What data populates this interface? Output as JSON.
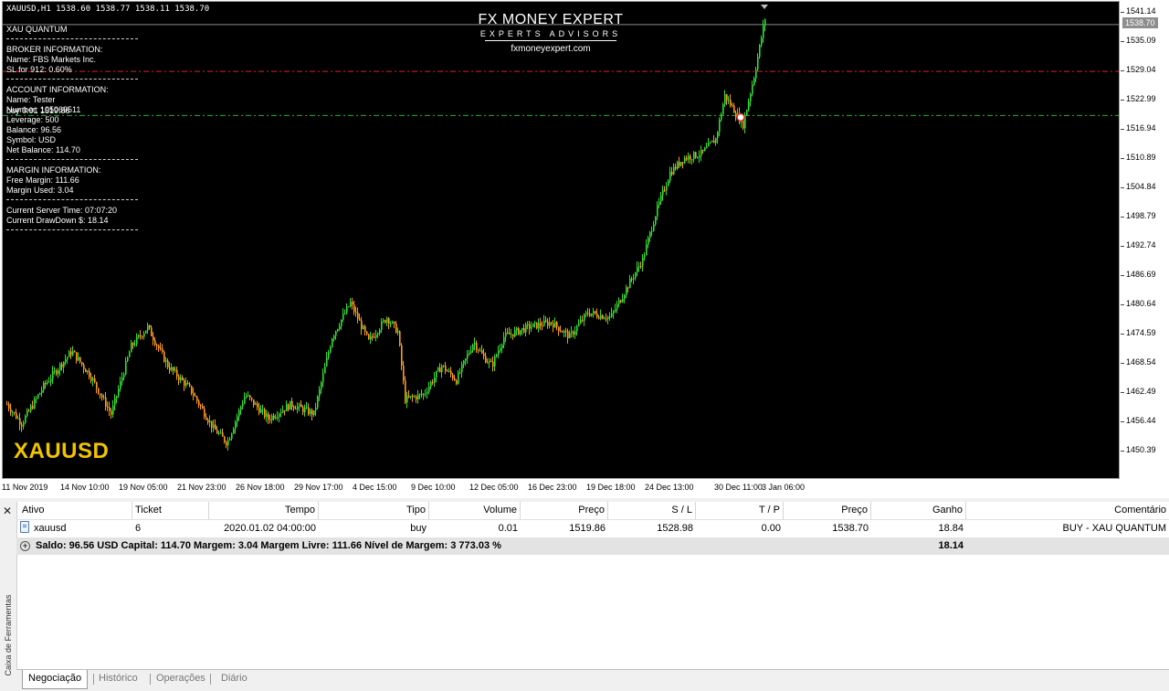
{
  "chart": {
    "header": "XAUUSD,H1  1538.60 1538.77 1538.11 1538.70",
    "symbol_watermark": "XAUUSD",
    "logo": {
      "title": "FX MONEY EXPERT",
      "subtitle": "EXPERTS ADVISORS",
      "url": "fxmoneyexpert.com"
    },
    "current_price": "1538.70",
    "price_ticks": [
      "1541.14",
      "1535.09",
      "1529.04",
      "1522.99",
      "1516.94",
      "1510.89",
      "1504.84",
      "1498.79",
      "1492.74",
      "1486.69",
      "1480.64",
      "1474.59",
      "1468.54",
      "1462.49",
      "1456.44",
      "1450.39"
    ],
    "time_ticks": [
      "11 Nov 2019",
      "14 Nov 10:00",
      "19 Nov 05:00",
      "21 Nov 23:00",
      "26 Nov 18:00",
      "29 Nov 17:00",
      "4 Dec 15:00",
      "9 Dec 10:00",
      "12 Dec 05:00",
      "16 Dec 23:00",
      "19 Dec 18:00",
      "24 Dec 13:00",
      "30 Dec 11:00",
      "3 Jan 06:00"
    ],
    "levels": {
      "stop_loss": 1528.98,
      "entry": 1519.86,
      "current": 1538.7
    },
    "colors": {
      "up": "#33dd33",
      "down": "#ff9a1a",
      "stop_line": "#e02020",
      "entry_line": "#22b822",
      "background": "#000000"
    }
  },
  "info_panel": {
    "lines_1": [
      "XAU QUANTUM"
    ],
    "lines_2": [
      "BROKER INFORMATION:",
      "Name: FBS Markets Inc.",
      "SL for 912: 0.60%"
    ],
    "lines_3": [
      "ACCOUNT INFORMATION:",
      "Name: Tester",
      "Number: 105069511",
      "Leverage: 500",
      "Balance: 96.56",
      "Symbol: USD",
      "Net Balance: 114.70"
    ],
    "overlay_entry": "buy 0.01 1519.86",
    "lines_4": [
      "MARGIN INFORMATION:",
      "Free Margin: 111.66",
      "Margin Used: 3.04"
    ],
    "lines_5": [
      "Current Server Time: 07:07:20",
      "Current DrawDown $: 18.14"
    ]
  },
  "toolbox": {
    "title": "Caixa de Ferramentas",
    "close_icon": "close-icon",
    "columns": [
      "Ativo",
      "Ticket",
      "Tempo",
      "Tipo",
      "Volume",
      "Preço",
      "S / L",
      "T / P",
      "Preço",
      "Ganho",
      "Comentário"
    ],
    "rows": [
      {
        "ativo": "xauusd",
        "ticket": "6",
        "tempo": "2020.01.02 04:00:00",
        "tipo": "buy",
        "volume": "0.01",
        "preco": "1519.86",
        "sl": "1528.98",
        "tp": "0.00",
        "preco_atual": "1538.70",
        "ganho": "18.84",
        "comentario": "BUY - XAU QUANTUM"
      }
    ],
    "summary": {
      "text": "Saldo: 96.56 USD  Capital: 114.70  Margem: 3.04  Margem Livre: 111.66  Nível de Margem: 3 773.03 %",
      "total": "18.14"
    },
    "tabs": [
      "Negociação",
      "Histórico",
      "Operações",
      "Diário"
    ],
    "active_tab": 0
  }
}
